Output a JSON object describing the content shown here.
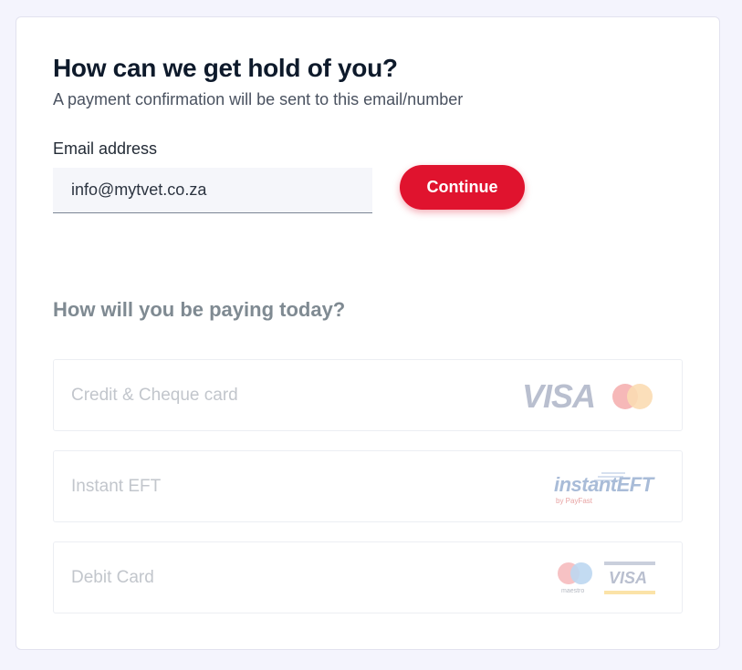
{
  "contact": {
    "title": "How can we get hold of you?",
    "subtitle": "A payment confirmation will be sent to this email/number",
    "email_label": "Email address",
    "email_value": "info@mytvet.co.za",
    "continue_label": "Continue"
  },
  "payment": {
    "title": "How will you be paying today?",
    "options": [
      {
        "label": "Credit & Cheque card",
        "logo_text": "VISA"
      },
      {
        "label": "Instant EFT",
        "logo_text": "instantEFT",
        "logo_sub": "by PayFast"
      },
      {
        "label": "Debit Card",
        "logo_text": "VISA",
        "logo_sub": "maestro"
      }
    ]
  },
  "colors": {
    "background": "#f4f4fd",
    "accent": "#e0132e",
    "heading": "#0e1a2b",
    "muted_heading": "#7f8a92",
    "disabled_text": "#c2c6cc"
  }
}
